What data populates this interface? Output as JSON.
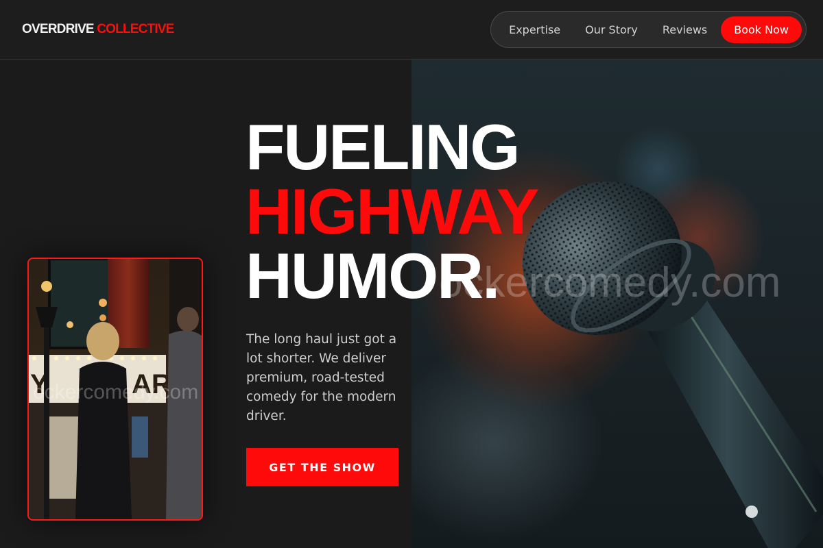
{
  "header": {
    "logo_primary": "OVERDRIVE",
    "logo_accent": "COLLECTIVE",
    "nav": [
      {
        "label": "Expertise"
      },
      {
        "label": "Our Story"
      },
      {
        "label": "Reviews"
      }
    ],
    "cta_label": "Book Now"
  },
  "hero": {
    "headline_line1": "FUELING",
    "headline_line2": "HIGHWAY",
    "headline_line3": "HUMOR.",
    "tagline": "The long haul just got a lot shorter. We deliver premium, road-tested comedy for the modern driver.",
    "cta_label": "GET THE SHOW",
    "watermark_large": "ockercomedy.com",
    "watermark_small": "ockercomedy.com"
  },
  "colors": {
    "accent": "#ff0a0a",
    "background": "#1b1b1c",
    "text": "#ffffff",
    "muted_text": "#cfcfcf"
  }
}
